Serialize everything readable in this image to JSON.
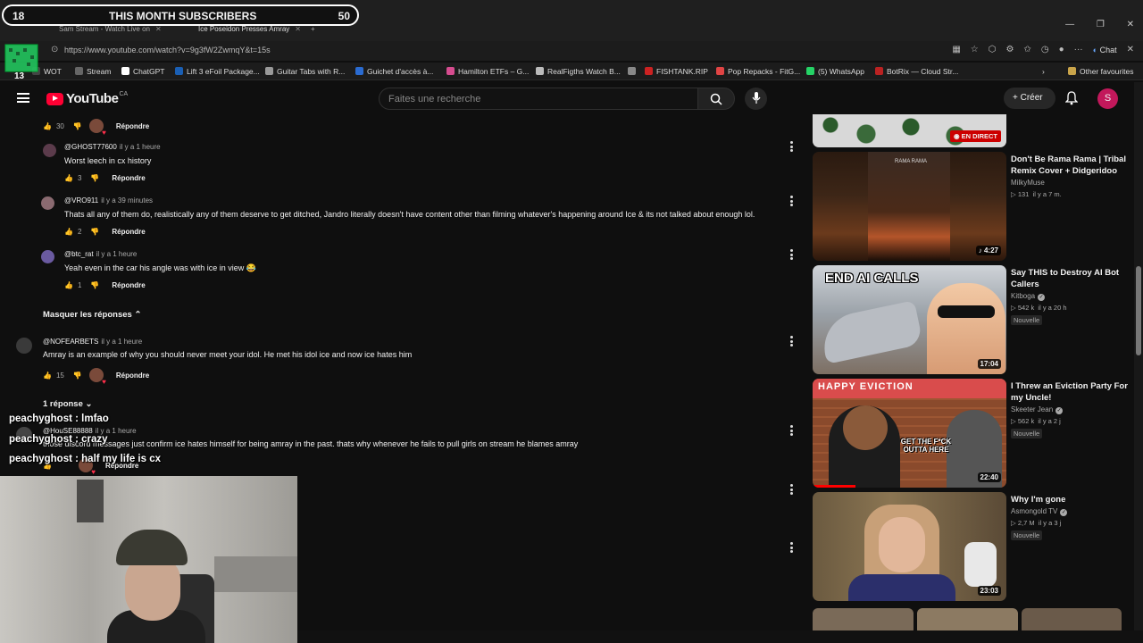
{
  "overlay": {
    "sub_left": "18",
    "sub_title": "THIS MONTH SUBSCRIBERS",
    "sub_right": "50"
  },
  "browser": {
    "tabs": [
      {
        "label": "Sam Stream - Watch Live on"
      },
      {
        "label": "Ice Poseidon Presses Amray"
      }
    ],
    "url": "https://www.youtube.com/watch?v=9g3fW2ZwmqY&t=15s",
    "chat_label": "Chat",
    "bookmarks": [
      {
        "label": "WOT",
        "color": "#444444"
      },
      {
        "label": "Stream",
        "color": "#666666"
      },
      {
        "label": "ChatGPT",
        "color": "#ffffff"
      },
      {
        "label": "Lift 3 eFoil Package...",
        "color": "#1a5fb4"
      },
      {
        "label": "Guitar Tabs with R...",
        "color": "#999999"
      },
      {
        "label": "Guichet d'accès à...",
        "color": "#2a6bd1"
      },
      {
        "label": "Hamilton ETFs – G...",
        "color": "#d64c8f"
      },
      {
        "label": "RealFigths Watch B...",
        "color": "#bbbbbb"
      },
      {
        "label": "",
        "color": "#888888"
      },
      {
        "label": "FISHTANK.RIP",
        "color": "#cc2222"
      },
      {
        "label": "Pop Repacks - FitG...",
        "color": "#e04444"
      },
      {
        "label": "(5) WhatsApp",
        "color": "#25d366"
      },
      {
        "label": "BotRix — Cloud Str...",
        "color": "#bb2222"
      }
    ],
    "other_favourites": "Other favourites"
  },
  "youtube": {
    "logo_text": "YouTube",
    "country": "CA",
    "search_placeholder": "Faites une recherche",
    "create_label": "Créer",
    "avatar_letter": "S"
  },
  "comments": {
    "reply_label": "Répondre",
    "first_likes": "30",
    "replies": [
      {
        "author": "@GHOST77600",
        "time": "il y a 1 heure",
        "text": "Worst leech in cx history",
        "likes": "3",
        "avatar_color": "#5b3b4b"
      },
      {
        "author": "@VRO911",
        "time": "il y a 39 minutes",
        "text": "Thats all any of them do, realistically any of them deserve to get ditched, Jandro literally doesn't have content other than filming whatever's happening around Ice & its not talked about enough lol.",
        "likes": "2",
        "avatar_color": "#8a6a70"
      },
      {
        "author": "@btc_rat",
        "time": "il y a 1 heure",
        "text": "Yeah even in the car his angle was with ice in view 😂",
        "likes": "1",
        "avatar_color": "#6a5aa0"
      }
    ],
    "hide_replies": "Masquer les réponses",
    "top2": {
      "author": "@NOFEARBETS",
      "time": "il y a 1 heure",
      "text": "Amray is an example of why you should never meet your idol. He met his idol ice and now ice hates him",
      "likes": "15"
    },
    "reply_count": "1 réponse",
    "top3": {
      "author": "@HouSE88888",
      "time": "il y a 1 heure",
      "text": "those discord messages just confirm ice hates himself for being amray in the past. thats why whenever he fails to pull girls on stream he blames amray"
    }
  },
  "chat_overlay": [
    "peachyghost : lmfao",
    "peachyghost : crazy",
    "peachyghost : half my life is cx"
  ],
  "sidebar": {
    "live_label": "EN DIRECT",
    "videos": [
      {
        "title": "Don't Be Rama Rama | Tribal Remix Cover + Didgeridoo",
        "channel": "MilkyMuse",
        "verified": false,
        "views": "131",
        "age": "il y a 7 m.",
        "duration": "4:27",
        "badge": ""
      },
      {
        "title": "Say THIS to Destroy AI Bot Callers",
        "channel": "Kitboga",
        "verified": true,
        "views": "542 k",
        "age": "il y a 20 h",
        "duration": "17:04",
        "badge": "Nouvelle"
      },
      {
        "title": "I Threw an Eviction Party For my Uncle!",
        "channel": "Skeeter Jean",
        "verified": true,
        "views": "562 k",
        "age": "il y a 2 j",
        "duration": "22:40",
        "badge": "Nouvelle"
      },
      {
        "title": "Why I'm gone",
        "channel": "Asmongold TV",
        "verified": true,
        "views": "2,7 M",
        "age": "il y a 3 j",
        "duration": "23:03",
        "badge": "Nouvelle"
      }
    ],
    "thumb_texts": {
      "end_ai": "END AI CALLS",
      "happy_eviction": "HAPPY EVICTION",
      "get_outta": "GET THE F*CK OUTTA HERE",
      "rama_title": "RAMA RAMA"
    }
  }
}
